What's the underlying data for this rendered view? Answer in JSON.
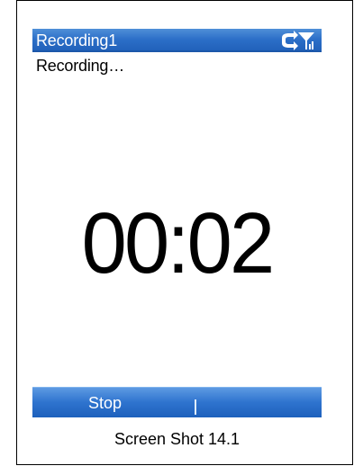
{
  "window": {
    "title": "Recording1"
  },
  "status": {
    "text": "Recording…"
  },
  "timer": {
    "elapsed": "00:02"
  },
  "softkeys": {
    "left_label": "Stop"
  },
  "caption": {
    "text": "Screen Shot 14.1"
  },
  "icons": {
    "connection": "connection-icon",
    "signal": "signal-icon"
  },
  "colors": {
    "title_bar_blue": "#2c6fc8",
    "softkey_blue": "#2f74cf",
    "text_dark": "#000000",
    "text_light": "#ffffff"
  }
}
